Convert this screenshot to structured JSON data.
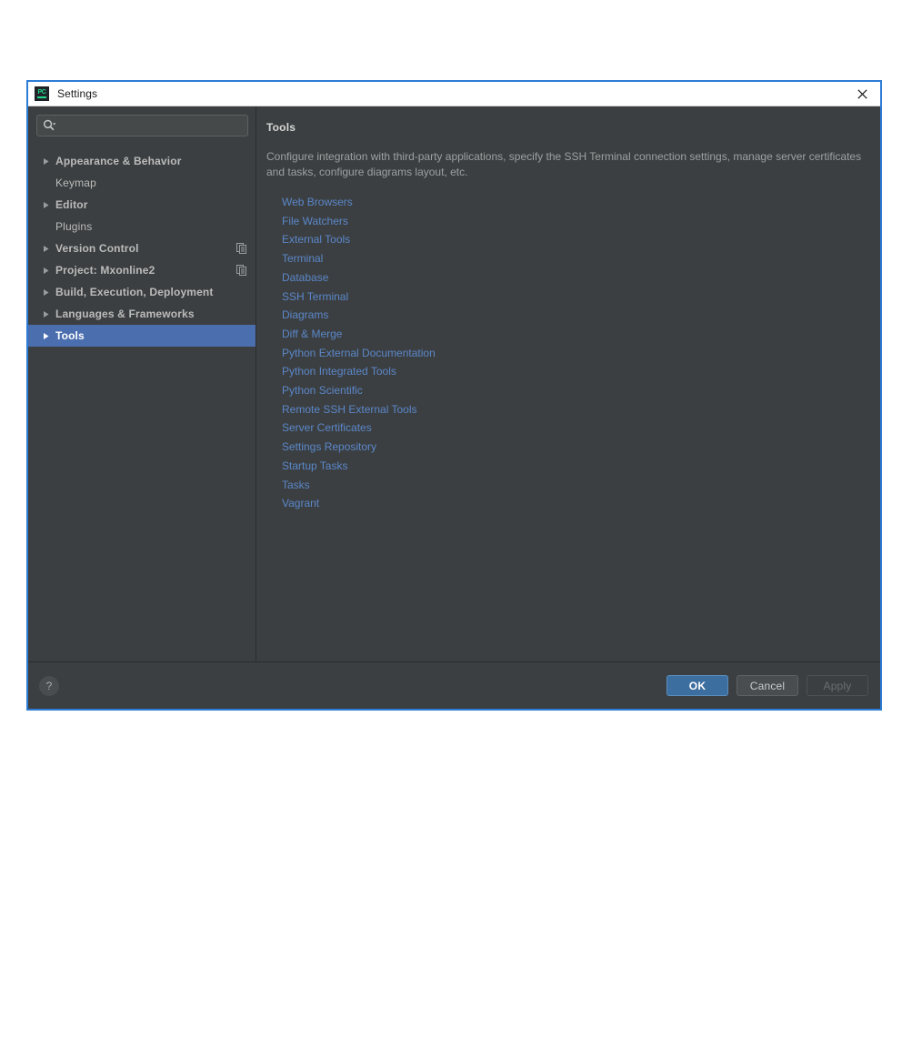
{
  "window": {
    "title": "Settings",
    "app_icon": "pycharm-icon",
    "app_icon_text": "PC",
    "close_icon": "close-icon",
    "border_color": "#2d7cd6"
  },
  "sidebar": {
    "search": {
      "placeholder": "",
      "value": "",
      "icon": "search-icon",
      "dropdown_icon": "chevron-down-icon"
    },
    "items": [
      {
        "label": "Appearance & Behavior",
        "expandable": true,
        "selected": false,
        "badge": false
      },
      {
        "label": "Keymap",
        "expandable": false,
        "selected": false,
        "badge": false
      },
      {
        "label": "Editor",
        "expandable": true,
        "selected": false,
        "badge": false
      },
      {
        "label": "Plugins",
        "expandable": false,
        "selected": false,
        "badge": false
      },
      {
        "label": "Version Control",
        "expandable": true,
        "selected": false,
        "badge": true
      },
      {
        "label": "Project: Mxonline2",
        "expandable": true,
        "selected": false,
        "badge": true
      },
      {
        "label": "Build, Execution, Deployment",
        "expandable": true,
        "selected": false,
        "badge": false
      },
      {
        "label": "Languages & Frameworks",
        "expandable": true,
        "selected": false,
        "badge": false
      },
      {
        "label": "Tools",
        "expandable": true,
        "selected": true,
        "badge": false
      }
    ]
  },
  "content": {
    "title": "Tools",
    "description": "Configure integration with third-party applications, specify the SSH Terminal connection settings, manage server certificates and tasks, configure diagrams layout, etc.",
    "links": [
      "Web Browsers",
      "File Watchers",
      "External Tools",
      "Terminal",
      "Database",
      "SSH Terminal",
      "Diagrams",
      "Diff & Merge",
      "Python External Documentation",
      "Python Integrated Tools",
      "Python Scientific",
      "Remote SSH External Tools",
      "Server Certificates",
      "Settings Repository",
      "Startup Tasks",
      "Tasks",
      "Vagrant"
    ],
    "link_color": "#5a87c9"
  },
  "footer": {
    "help_label": "?",
    "ok_label": "OK",
    "cancel_label": "Cancel",
    "apply_label": "Apply",
    "apply_disabled": true,
    "ok_color": "#3c6e9f"
  }
}
